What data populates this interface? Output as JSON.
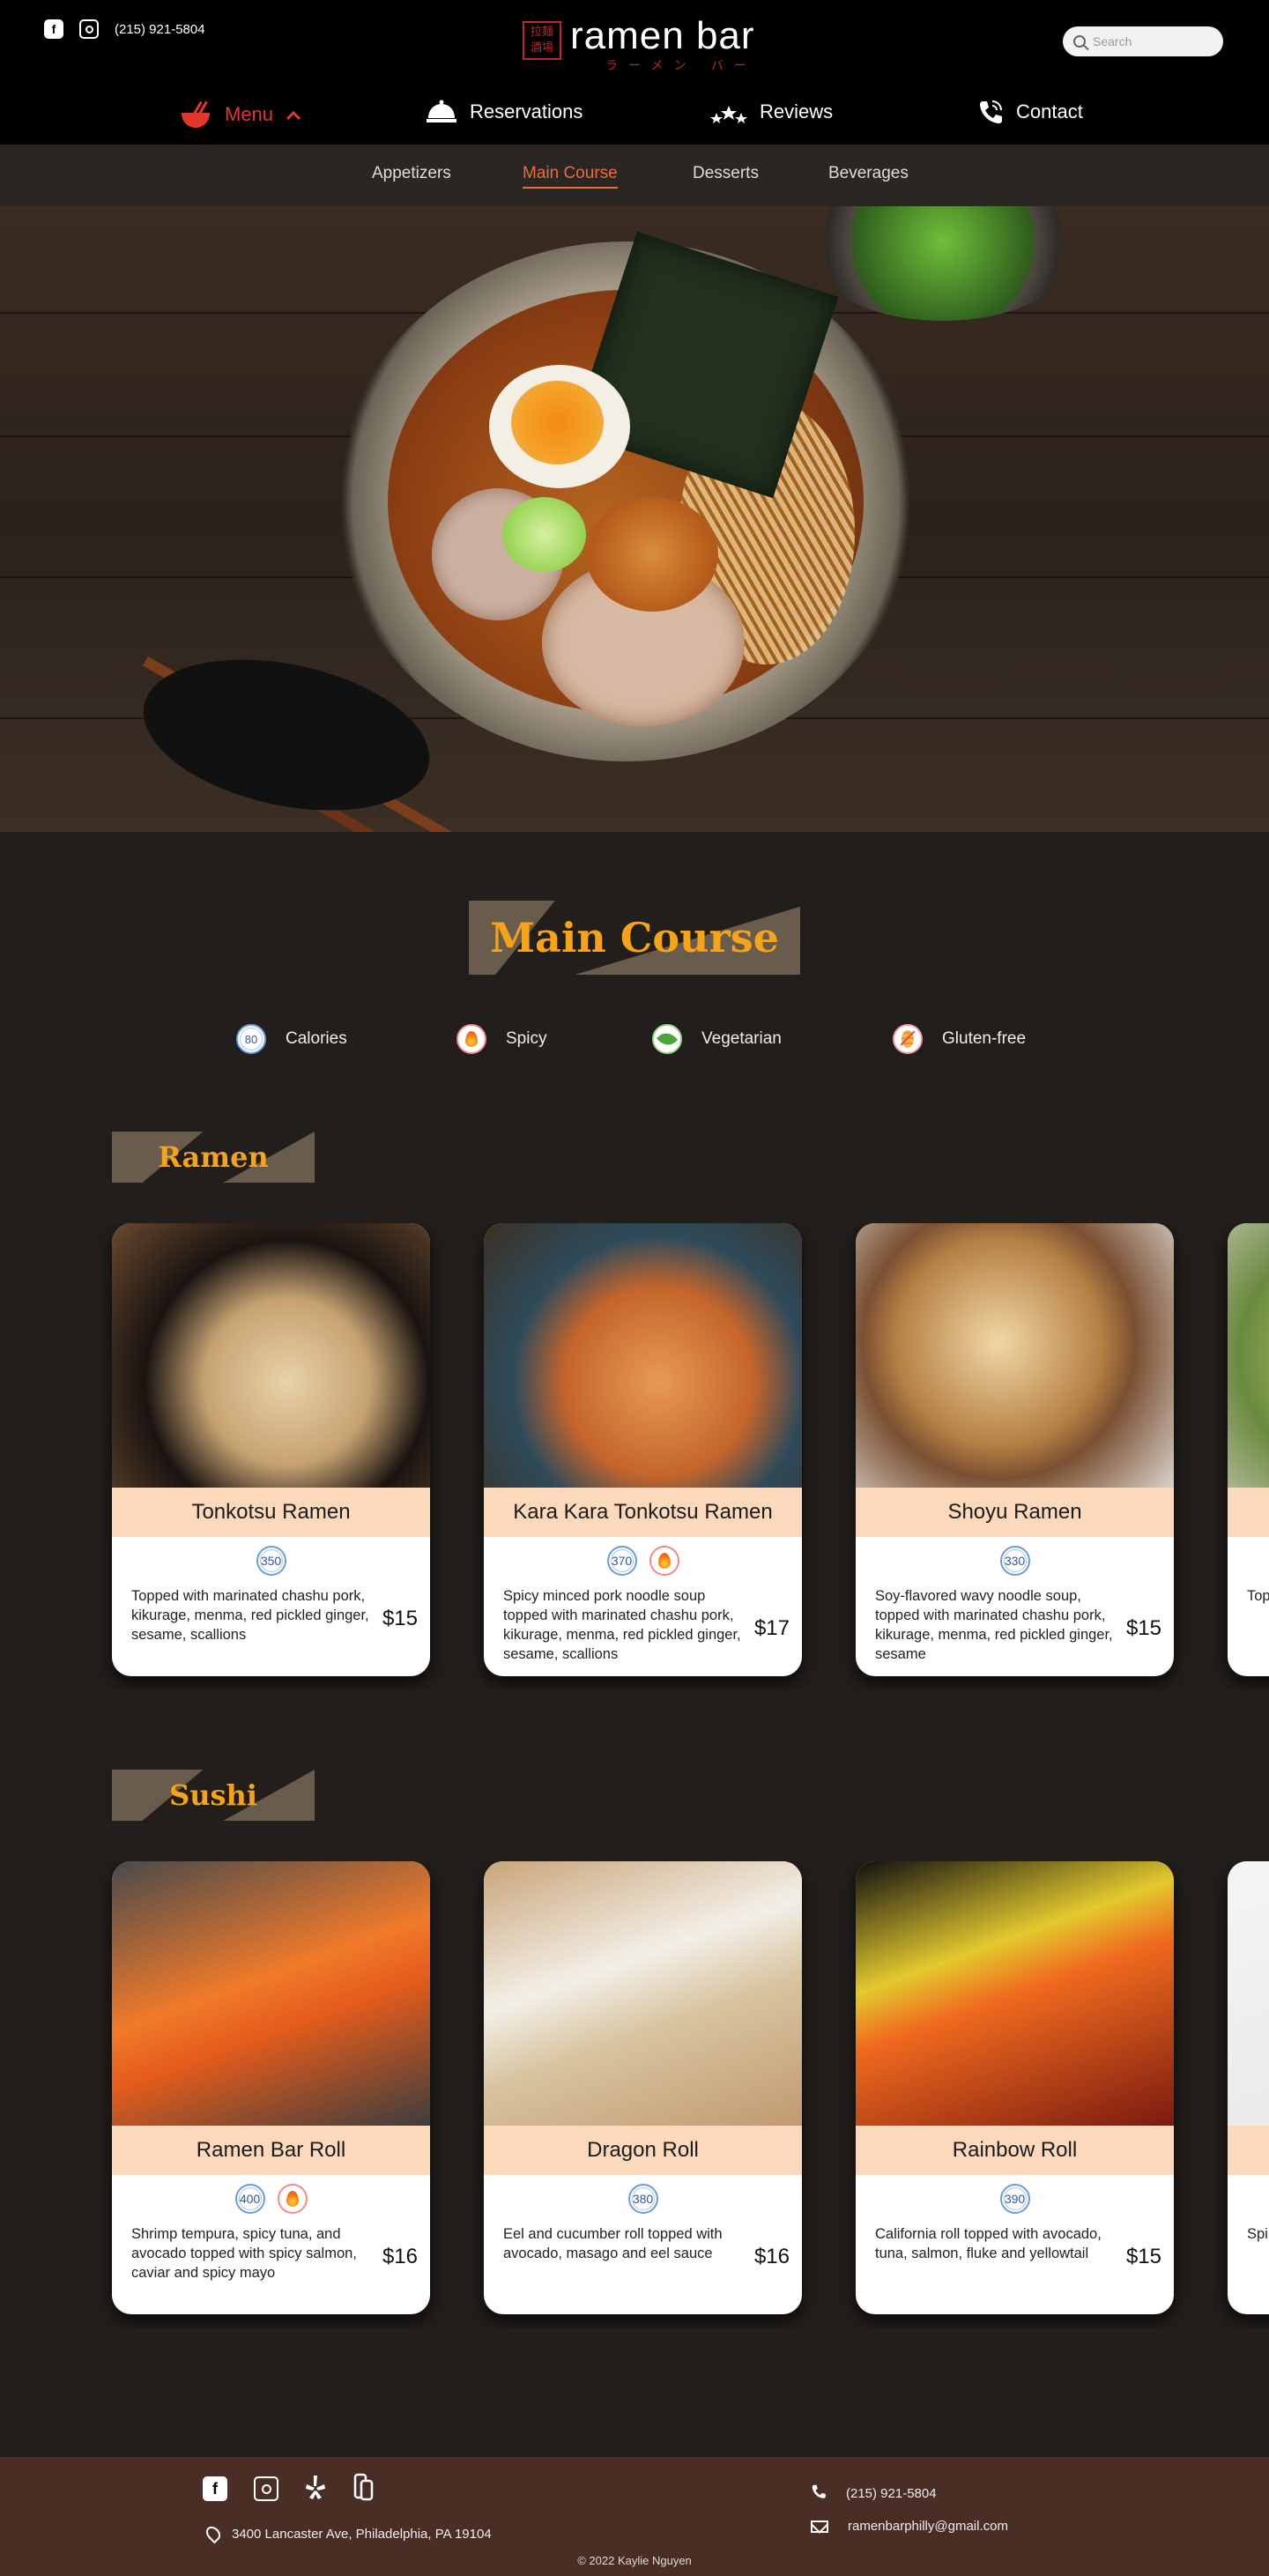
{
  "header": {
    "phone": "(215) 921-5804",
    "logo_name": "ramen bar",
    "logo_sub": "ラーメン バー",
    "logo_seal": "拉麺酒場",
    "search_placeholder": "Search",
    "nav": [
      {
        "label": "Menu",
        "icon": "ramen-bowl-icon",
        "active": true
      },
      {
        "label": "Reservations",
        "icon": "cloche-icon"
      },
      {
        "label": "Reviews",
        "icon": "stars-icon"
      },
      {
        "label": "Contact",
        "icon": "phone-icon"
      }
    ]
  },
  "subnav": [
    "Appetizers",
    "Main Course",
    "Desserts",
    "Beverages"
  ],
  "page_title": "Main Course",
  "legend": [
    {
      "badge": "80",
      "label": "Calories"
    },
    {
      "badge": "",
      "label": "Spicy"
    },
    {
      "badge": "",
      "label": "Vegetarian"
    },
    {
      "badge": "",
      "label": "Gluten-free"
    }
  ],
  "sections": [
    {
      "title": "Ramen",
      "items": [
        {
          "name": "Tonkotsu Ramen",
          "calories": "350",
          "spicy": false,
          "desc": "Topped with marinated chashu pork, kikurage, menma, red pickled ginger, sesame, scallions",
          "price": "$15"
        },
        {
          "name": "Kara Kara Tonkotsu Ramen",
          "calories": "370",
          "spicy": true,
          "desc": "Spicy minced pork noodle soup topped with marinated chashu pork, kikurage, menma, red pickled ginger, sesame, scallions",
          "price": "$17"
        },
        {
          "name": "Shoyu Ramen",
          "calories": "330",
          "spicy": false,
          "desc": "Soy-flavored wavy noodle soup, topped with marinated chashu pork, kikurage, menma, red pickled ginger, sesame",
          "price": "$15"
        },
        {
          "name": "",
          "calories": "",
          "spicy": false,
          "desc": "Top por nar sca",
          "price": ""
        }
      ]
    },
    {
      "title": "Sushi",
      "items": [
        {
          "name": "Ramen Bar Roll",
          "calories": "400",
          "spicy": true,
          "desc": "Shrimp tempura, spicy tuna, and avocado topped with spicy salmon, caviar and spicy mayo",
          "price": "$16"
        },
        {
          "name": "Dragon Roll",
          "calories": "380",
          "spicy": false,
          "desc": "Eel and cucumber roll topped with avocado, masago and eel sauce",
          "price": "$16"
        },
        {
          "name": "Rainbow Roll",
          "calories": "390",
          "spicy": false,
          "desc": "California roll topped with avocado, tuna, salmon, fluke and yellowtail",
          "price": "$15"
        },
        {
          "name": "",
          "calories": "",
          "spicy": false,
          "desc": "Spi cuc sal",
          "price": ""
        }
      ]
    }
  ],
  "footer": {
    "address": "3400 Lancaster Ave, Philadelphia, PA 19104",
    "phone": "(215) 921-5804",
    "email": "ramenbarphilly@gmail.com",
    "copyright": "2022 Kaylie Nguyen",
    "social": [
      "facebook-icon",
      "instagram-icon",
      "yelp-icon",
      "grubhub-icon"
    ]
  },
  "colors": {
    "accent": "#e0382d",
    "title_gold": "#f4a31a",
    "name_band": "#fcd9bb",
    "footer_bg": "#4a2e25",
    "page_bg": "#221e1b"
  }
}
